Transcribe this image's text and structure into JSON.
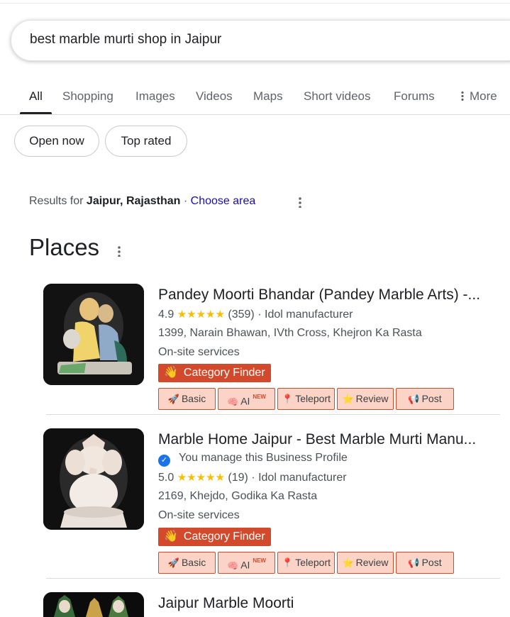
{
  "search": {
    "query": "best marble murti shop in Jaipur"
  },
  "tabs": [
    {
      "label": "All"
    },
    {
      "label": "Shopping"
    },
    {
      "label": "Images"
    },
    {
      "label": "Videos"
    },
    {
      "label": "Maps"
    },
    {
      "label": "Short videos"
    },
    {
      "label": "Forums"
    },
    {
      "label": "More"
    }
  ],
  "chips": [
    {
      "label": "Open now"
    },
    {
      "label": "Top rated"
    }
  ],
  "location": {
    "prefix": "Results for",
    "place": "Jaipur, Rajasthan",
    "separator": "·",
    "link": "Choose area"
  },
  "places": {
    "title": "Places",
    "items": [
      {
        "name": "Pandey Moorti Bhandar (Pandey Marble Arts) -...",
        "rating": "4.9",
        "stars": "★★★★★",
        "reviews": "(359)",
        "category": "· Idol manufacturer",
        "address": "1399, Narain Bhawan, IVth Cross, Khejron Ka Rasta",
        "service": "On-site services",
        "category_finder": "Category Finder"
      },
      {
        "name": "Marble Home Jaipur - Best Marble Murti Manu...",
        "managed": "You manage this Business Profile",
        "rating": "5.0",
        "stars": "★★★★★",
        "reviews": "(19)",
        "category": "· Idol manufacturer",
        "address": "2169, Khejdo, Godika Ka Rasta",
        "service": "On-site services",
        "category_finder": "Category Finder"
      },
      {
        "name": "Jaipur Marble Moorti"
      }
    ]
  },
  "tool_buttons": {
    "basic": "Basic",
    "ai": "AI",
    "ai_badge": "NEW",
    "teleport": "Teleport",
    "review": "Review",
    "post": "Post"
  },
  "colors": {
    "link": "#1a0dab",
    "star": "#fbbc04",
    "extension_accent": "#d24a2b",
    "extension_button_bg": "#fbd3c7",
    "verified": "#1a73e8"
  },
  "icons": {
    "basic": "rocket-icon",
    "ai": "brain-icon",
    "teleport": "map-pin-icon",
    "review": "star-icon",
    "post": "megaphone-icon",
    "category_finder": "waving-hand-icon"
  }
}
